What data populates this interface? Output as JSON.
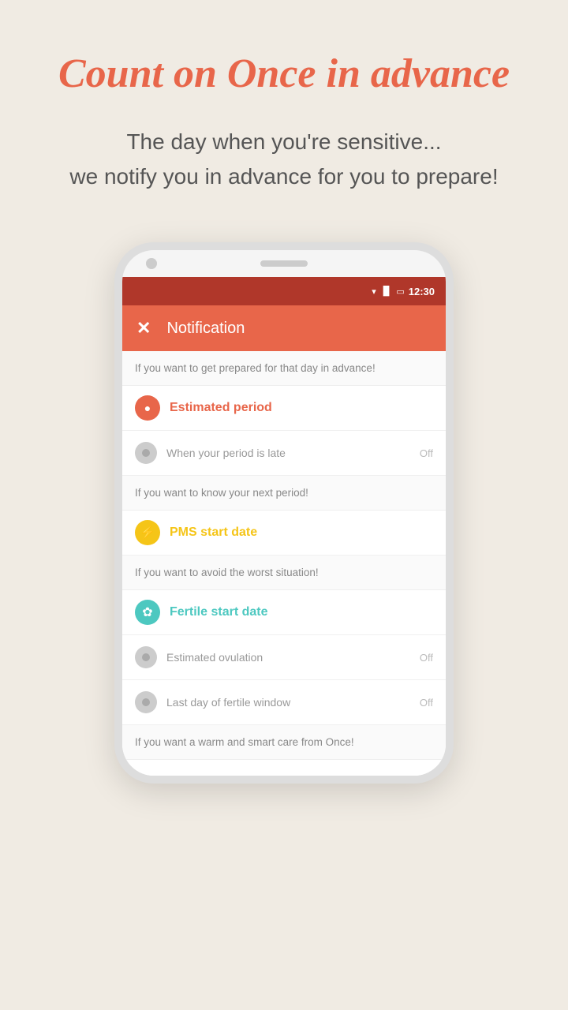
{
  "page": {
    "background_color": "#f0ebe3"
  },
  "hero": {
    "title": "Count on Once in advance",
    "subtitle_line1": "The day when you're sensitive...",
    "subtitle_line2": "we notify you in advance for you to prepare!"
  },
  "status_bar": {
    "time": "12:30"
  },
  "app_header": {
    "close_icon": "✕",
    "title": "Notification"
  },
  "sections": [
    {
      "desc": "If you want to get prepared for that day in advance!",
      "header_label": "Estimated period",
      "header_color": "red",
      "header_icon": "●",
      "toggles": [
        {
          "label": "When your period is late",
          "state": "Off"
        }
      ]
    },
    {
      "desc": "If you want to know your next period!",
      "header_label": "PMS start date",
      "header_color": "yellow",
      "header_icon": "⚡",
      "toggles": []
    },
    {
      "desc": "If you want to avoid the worst situation!",
      "header_label": "Fertile start date",
      "header_color": "teal",
      "header_icon": "✿",
      "toggles": [
        {
          "label": "Estimated ovulation",
          "state": "Off"
        },
        {
          "label": "Last day of fertile window",
          "state": "Off"
        }
      ]
    }
  ],
  "footer_desc": "If you want a warm and smart care from Once!"
}
